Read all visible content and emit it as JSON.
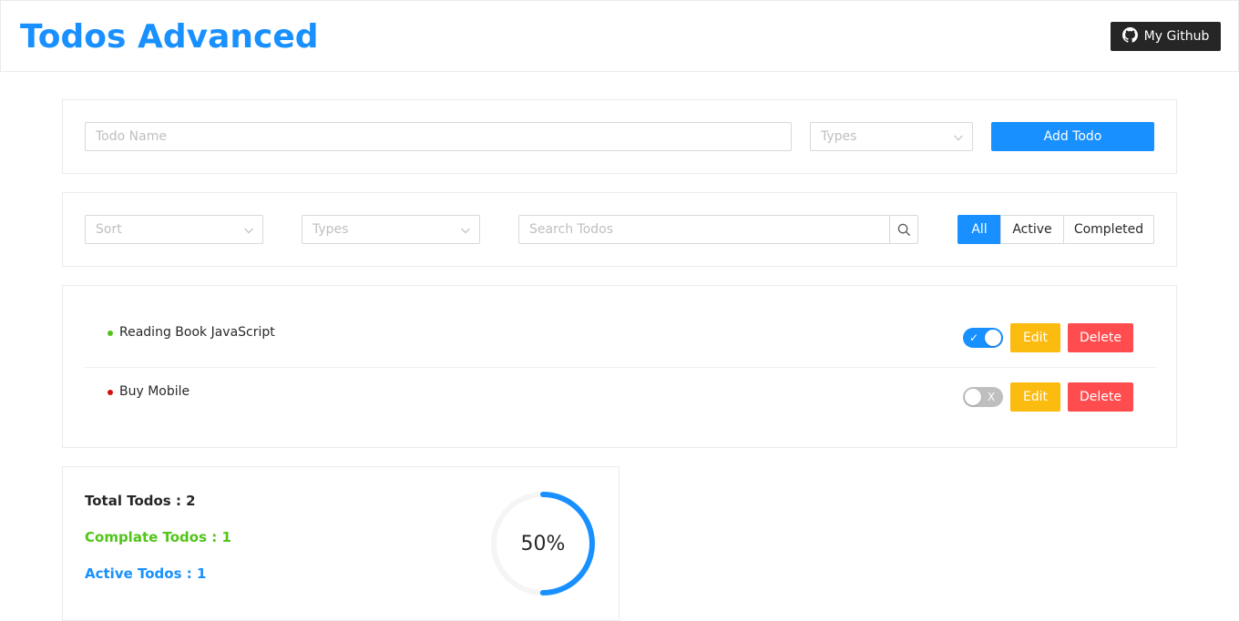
{
  "header": {
    "title": "Todos Advanced",
    "github_label": "My Github"
  },
  "add_form": {
    "name_placeholder": "Todo Name",
    "types_placeholder": "Types",
    "add_button": "Add Todo"
  },
  "filters": {
    "sort_placeholder": "Sort",
    "types_placeholder": "Types",
    "search_placeholder": "Search Todos",
    "tabs": [
      {
        "label": "All",
        "active": true
      },
      {
        "label": "Active",
        "active": false
      },
      {
        "label": "Completed",
        "active": false
      }
    ]
  },
  "todos": [
    {
      "name": "Reading Book JavaScript",
      "dot_color": "#52c41a",
      "completed": true,
      "edit_label": "Edit",
      "delete_label": "Delete",
      "switch_mark": "✓"
    },
    {
      "name": "Buy Mobile",
      "dot_color": "#d4100f",
      "completed": false,
      "edit_label": "Edit",
      "delete_label": "Delete",
      "switch_mark": "X"
    }
  ],
  "stats": {
    "total": "Total Todos : 2",
    "complete": "Complate Todos : 1",
    "active": "Active Todos : 1",
    "progress_percent": 50,
    "progress_label": "50%"
  },
  "colors": {
    "primary": "#1890ff",
    "warning": "#fcbb0f",
    "danger": "#ff4d4f",
    "success": "#52c41a",
    "dark": "#262626"
  }
}
